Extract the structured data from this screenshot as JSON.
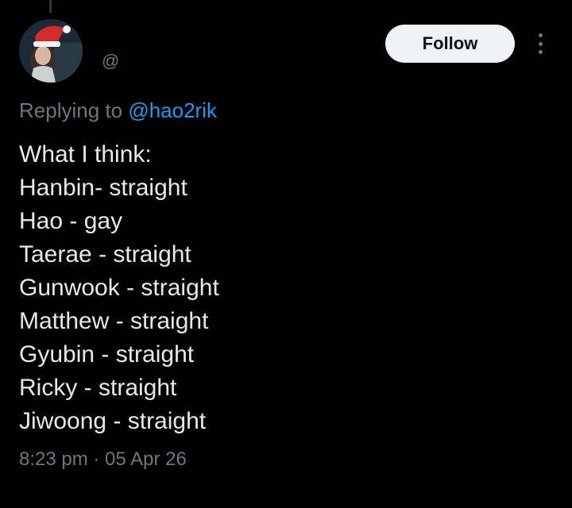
{
  "tweet": {
    "author": {
      "handle": "@"
    },
    "follow_label": "Follow",
    "reply": {
      "prefix": "Replying to ",
      "mention": "@hao2rik"
    },
    "lines": [
      "What I think:",
      "Hanbin- straight",
      "Hao - gay",
      "Taerae - straight",
      "Gunwook - straight",
      "Matthew - straight",
      "Gyubin - straight",
      "Ricky - straight",
      "Jiwoong - straight"
    ],
    "timestamp": "8:23 pm · 05 Apr 26"
  },
  "icons": {
    "more": "more-vertical-icon",
    "avatar": "santa-hat-avatar"
  },
  "colors": {
    "background": "#000000",
    "text": "#e7e9ea",
    "muted": "#71767b",
    "accent": "#1d9bf0",
    "follow_bg": "#eff3f4"
  }
}
